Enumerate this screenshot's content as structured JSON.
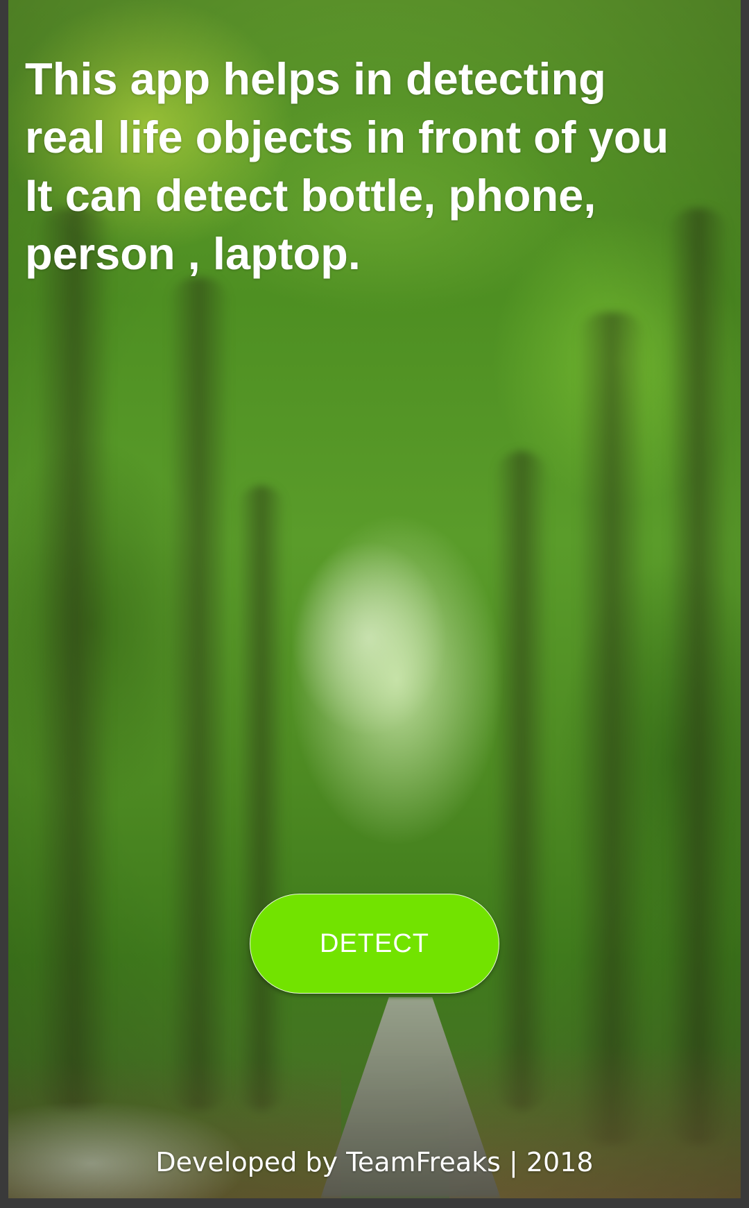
{
  "app": {
    "description": "This app helps in detecting\nreal life objects in front of you\nIt can detect bottle, phone,\nperson , laptop.",
    "detect_button_label": "DETECT",
    "footer_text": "Developed by TeamFreaks | 2018"
  },
  "colors": {
    "button_background": "#72e300",
    "text": "#ffffff",
    "frame": "#3a3a3a"
  },
  "background": {
    "description_icon": "forest-path-background"
  }
}
